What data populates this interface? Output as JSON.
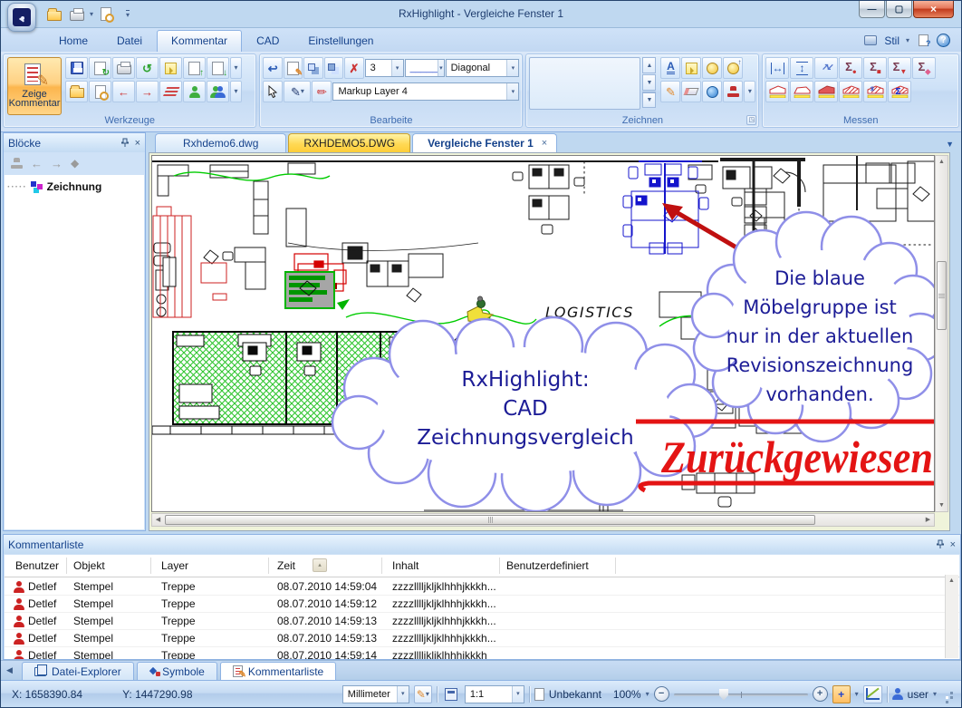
{
  "window": {
    "title": "RxHighlight - Vergleiche Fenster 1"
  },
  "menu_tabs": [
    {
      "label": "Home"
    },
    {
      "label": "Datei"
    },
    {
      "label": "Kommentar"
    },
    {
      "label": "CA­D"
    },
    {
      "label": "Einstellungen"
    }
  ],
  "menu_tab_cad": "CAD",
  "titlebar_right": {
    "stil_label": "Stil"
  },
  "ribbon": {
    "werkzeuge": {
      "label": "Werkzeuge",
      "big_button_line1": "Zeige",
      "big_button_line2": "Kommentar"
    },
    "bearbeite": {
      "label": "Bearbeite",
      "width_value": "3",
      "linestyle_value": "_____",
      "hatch_value": "Diagonal",
      "layer_value": "Markup Layer 4"
    },
    "zeichnen": {
      "label": "Zeichnen"
    },
    "messen": {
      "label": "Messen"
    }
  },
  "blocks_panel": {
    "title": "Blöcke",
    "tree_item_label": "Zeichnung"
  },
  "doc_tabs": [
    {
      "label": "Rxhdemo6.dwg"
    },
    {
      "label": "RXHDEMO5.DWG"
    },
    {
      "label": "Vergleiche Fenster 1"
    }
  ],
  "drawing": {
    "logistics_label": "LOGISTICS",
    "cloud1_line1": "RxHighlight:",
    "cloud1_line2": "CAD",
    "cloud1_line3": "Zeichnungsvergleich",
    "cloud2_line1": "Die blaue",
    "cloud2_line2": "Möbelgruppe ist",
    "cloud2_line3": "nur in der aktuellen",
    "cloud2_line4": "Revisionszeichnung",
    "cloud2_line5": "vorhanden.",
    "stamp_text": "Zurückgewiesen"
  },
  "comment_panel": {
    "title": "Kommentarliste",
    "columns": {
      "benutzer": "Benutzer",
      "objekt": "Objekt",
      "layer": "Layer",
      "zeit": "Zeit",
      "inhalt": "Inhalt",
      "benutzerdefiniert": "Benutzerdefiniert"
    },
    "rows": [
      {
        "benutzer": "Detlef",
        "objekt": "Stempel",
        "layer": "Treppe",
        "zeit": "08.07.2010 14:59:04",
        "inhalt": "zzzzlllljkljklhhhjkkkh..."
      },
      {
        "benutzer": "Detlef",
        "objekt": "Stempel",
        "layer": "Treppe",
        "zeit": "08.07.2010 14:59:12",
        "inhalt": "zzzzlllljkljklhhhjkkkh..."
      },
      {
        "benutzer": "Detlef",
        "objekt": "Stempel",
        "layer": "Treppe",
        "zeit": "08.07.2010 14:59:13",
        "inhalt": "zzzzlllljkljklhhhjkkkh..."
      },
      {
        "benutzer": "Detlef",
        "objekt": "Stempel",
        "layer": "Treppe",
        "zeit": "08.07.2010 14:59:13",
        "inhalt": "zzzzlllljkljklhhhjkkkh..."
      },
      {
        "benutzer": "Detlef",
        "objekt": "Stempel",
        "layer": "Treppe",
        "zeit": "08.07.2010 14:59:14",
        "inhalt": "zzzzlllljkljklhhhjkkkh"
      }
    ]
  },
  "bottom_tabs": [
    {
      "label": "Datei-Explorer"
    },
    {
      "label": "Symbole"
    },
    {
      "label": "Kommentarliste"
    }
  ],
  "status_bar": {
    "x_coord": "X: 1658390.84",
    "y_coord": "Y: 1447290.98",
    "unit_value": "Millimeter",
    "scale_value": "1:1",
    "doc_status": "Unbekannt",
    "zoom_value": "100%",
    "user_label": "user"
  },
  "icons": {
    "dropdown": "▾",
    "left_arrow": "←",
    "right_arrow": "→",
    "undo": "↩",
    "redo_cw": "↻",
    "redo_ccw": "↺",
    "up_arrow": "↑",
    "down_arrow": "↓",
    "close": "×",
    "minimize": "—",
    "maximize": "▢",
    "up_tri": "▲",
    "down_tri": "▼",
    "left_tri": "◀",
    "right_tri": "▶",
    "sort": "▴",
    "sigma": "Σ",
    "circle": "●",
    "square": "■",
    "tri_down": "▼",
    "diamond": "◆",
    "cross": "✗",
    "pencil": "✎",
    "question": "?",
    "a_letter": "A",
    "diag_pair": "↗↙",
    "h_measure": "↔",
    "v_measure": "↕",
    "plus": "+",
    "minus": "−",
    "customize_dd": "▾"
  },
  "colors": {
    "accent_orange": "#fcb64e",
    "stamp_red": "#e41414",
    "cloud_stroke": "#8f8fe8",
    "cloud_text": "#1c1c96",
    "markup_green": "#00b400",
    "markup_red": "#d40000",
    "blue_group": "#1414cc"
  }
}
